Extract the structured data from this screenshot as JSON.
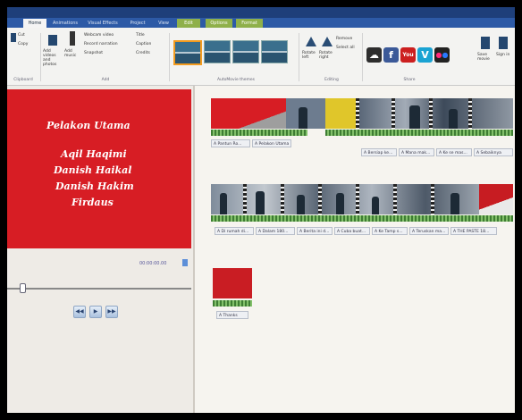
{
  "ribbon_tabs": [
    "Home",
    "Animations",
    "Visual Effects",
    "Project",
    "View",
    "Edit",
    "Options",
    "Format"
  ],
  "ribbon": {
    "clipboard": [
      "Cut",
      "Copy"
    ],
    "add": [
      "Add videos and photos",
      "Add music",
      "Webcam video",
      "Record narration",
      "Snapshot",
      "Title",
      "Caption",
      "Credits"
    ],
    "editing": [
      "Rotate left",
      "Rotate right",
      "Remove",
      "Select all"
    ],
    "share_icons": [
      "cloud",
      "facebook",
      "youtube",
      "vimeo",
      "flickr"
    ],
    "end": [
      "Save movie",
      "Sign in"
    ],
    "groups": [
      "Clipboard",
      "Add",
      "AutoMovie themes",
      "Editing",
      "Share"
    ]
  },
  "preview": {
    "title": "Pelakon Utama",
    "names": [
      "Aqil Haqimi",
      "Danish Haikal",
      "Danish Hakim",
      "Firdaus"
    ],
    "timecode": "00:00:00.00"
  },
  "playback": [
    "◀◀",
    "▶",
    "▶▶"
  ],
  "storyboard": {
    "row1_captions": [
      "A Pantun Ro...",
      "A Pelakon Utama"
    ],
    "row1b_captions": [
      "A Bersiap ke...",
      "A Mana mak...",
      "A Ke se mas...",
      "A Sebaiknya"
    ],
    "row2_captions": [
      "A Di rumah di...",
      "A Dalam 180...",
      "A Berita ini d...",
      "A Cuba buat...",
      "A Ke Tamp s...",
      "A Teruskan ma...",
      "A THE PASTE 18..."
    ],
    "row3_captions": [
      "A Thanks"
    ]
  },
  "colors": {
    "accent": "#d71d24",
    "ribbon_tab": "#2d5aa6",
    "audio": "#3e7d33"
  }
}
